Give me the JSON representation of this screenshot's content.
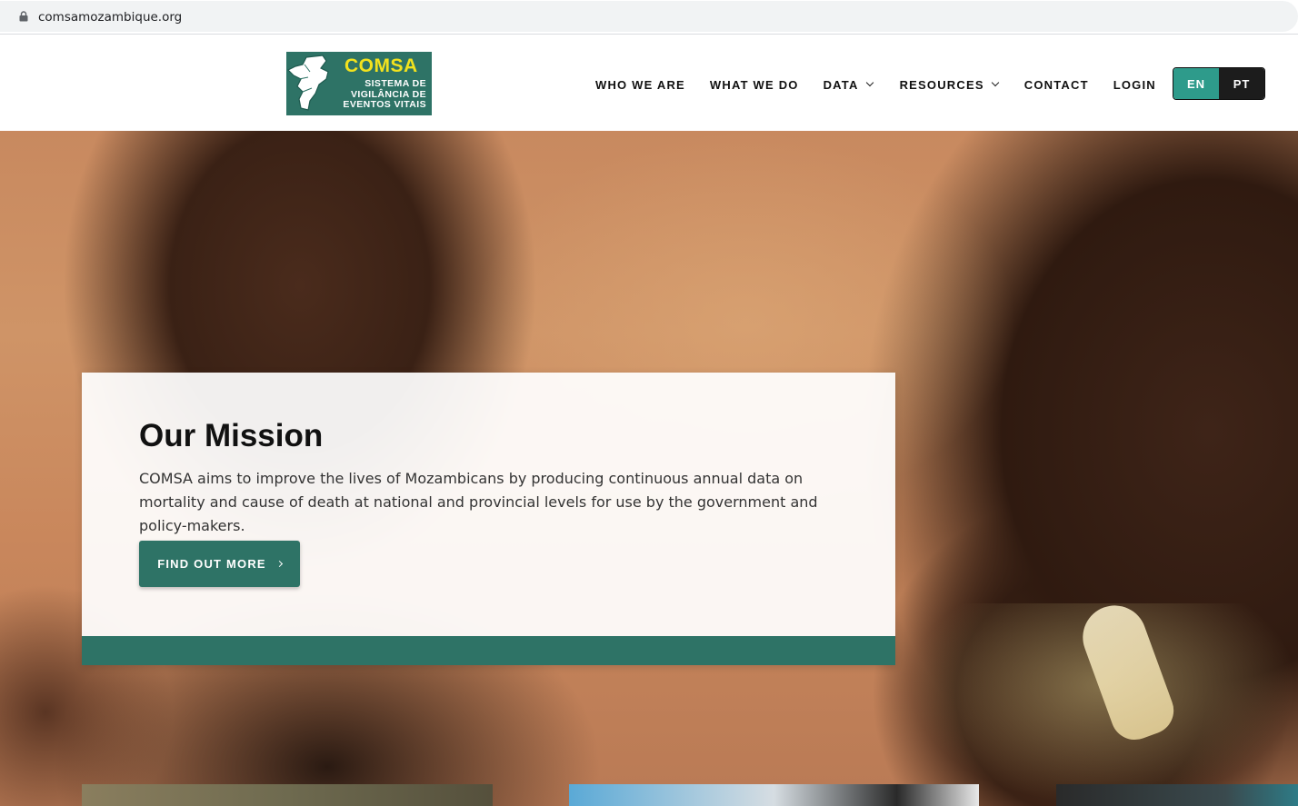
{
  "browser": {
    "url": "comsamozambique.org"
  },
  "logo": {
    "title": "COMSA",
    "subtitle_lines": [
      "SISTEMA DE",
      "VIGILÂNCIA DE",
      "EVENTOS VITAIS"
    ]
  },
  "nav": {
    "items": [
      {
        "label": "WHO WE ARE",
        "dropdown": false
      },
      {
        "label": "WHAT WE DO",
        "dropdown": false
      },
      {
        "label": "DATA",
        "dropdown": true
      },
      {
        "label": "RESOURCES",
        "dropdown": true
      },
      {
        "label": "CONTACT",
        "dropdown": false
      },
      {
        "label": "LOGIN",
        "dropdown": false
      }
    ]
  },
  "language": {
    "en": "EN",
    "pt": "PT",
    "active": "EN"
  },
  "mission": {
    "title": "Our Mission",
    "text": "COMSA aims to improve the lives of Mozambicans by producing continuous annual data on mortality and cause of death at national and provincial levels for use by the government and policy-makers.",
    "cta_label": "FIND OUT MORE"
  },
  "colors": {
    "brand_green": "#2e7366",
    "logo_yellow": "#f2e21d",
    "lang_active": "#2e9b8b",
    "lang_inactive": "#1c1c1c"
  }
}
